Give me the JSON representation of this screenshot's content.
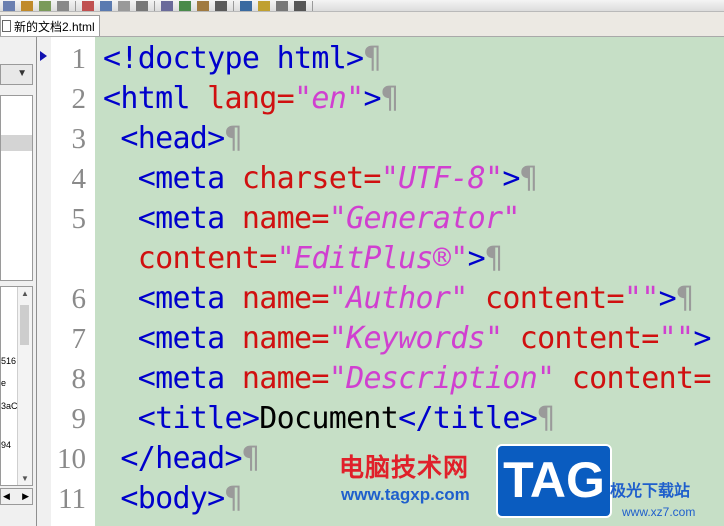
{
  "tab": {
    "label": "新的文档2.html"
  },
  "sidebar": {
    "list_items": [
      "516",
      "e",
      "3aC",
      "94"
    ],
    "scroll_up": "▲",
    "scroll_down": "▼",
    "bottom_left": "◀",
    "bottom_right": "▶",
    "combo_arrow": "▼"
  },
  "line_numbers": [
    "1",
    "2",
    "3",
    "4",
    "5",
    "",
    "6",
    "7",
    "8",
    "9",
    "10",
    "11"
  ],
  "code_lines": [
    [
      [
        "tag",
        "<!doctype html>"
      ],
      [
        "pil",
        "¶"
      ]
    ],
    [
      [
        "tag",
        "<html "
      ],
      [
        "attr",
        "lang="
      ],
      [
        "val",
        "\"en\""
      ],
      [
        "tag",
        ">"
      ],
      [
        "pil",
        "¶"
      ]
    ],
    [
      [
        "tag",
        " <head>"
      ],
      [
        "pil",
        "¶"
      ]
    ],
    [
      [
        "tag",
        "  <meta "
      ],
      [
        "attr",
        "charset="
      ],
      [
        "val",
        "\"UTF-8\""
      ],
      [
        "tag",
        ">"
      ],
      [
        "pil",
        "¶"
      ]
    ],
    [
      [
        "tag",
        "  <meta "
      ],
      [
        "attr",
        "name="
      ],
      [
        "val",
        "\"Generator\""
      ]
    ],
    [
      [
        "attr",
        "  content="
      ],
      [
        "val",
        "\"EditPlus®\""
      ],
      [
        "tag",
        ">"
      ],
      [
        "pil",
        "¶"
      ]
    ],
    [
      [
        "tag",
        "  <meta "
      ],
      [
        "attr",
        "name="
      ],
      [
        "val",
        "\"Author\""
      ],
      [
        "attr",
        " content="
      ],
      [
        "val",
        "\"\""
      ],
      [
        "tag",
        ">"
      ],
      [
        "pil",
        "¶"
      ]
    ],
    [
      [
        "tag",
        "  <meta "
      ],
      [
        "attr",
        "name="
      ],
      [
        "val",
        "\"Keywords\""
      ],
      [
        "attr",
        " content="
      ],
      [
        "val",
        "\"\""
      ],
      [
        "tag",
        ">"
      ]
    ],
    [
      [
        "tag",
        "  <meta "
      ],
      [
        "attr",
        "name="
      ],
      [
        "val",
        "\"Description\""
      ],
      [
        "attr",
        " content="
      ]
    ],
    [
      [
        "tag",
        "  <title>"
      ],
      [
        "txt",
        "Document"
      ],
      [
        "tag",
        "</title>"
      ],
      [
        "pil",
        "¶"
      ]
    ],
    [
      [
        "tag",
        " </head>"
      ],
      [
        "pil",
        "¶"
      ]
    ],
    [
      [
        "tag",
        " <body>"
      ],
      [
        "pil",
        "¶"
      ]
    ]
  ],
  "watermark": {
    "cn_text": "电脑技术网",
    "url": "www.tagxp.com",
    "badge": "TAG",
    "site_cn": "极光下载站",
    "site_url": "www.xz7.com"
  }
}
